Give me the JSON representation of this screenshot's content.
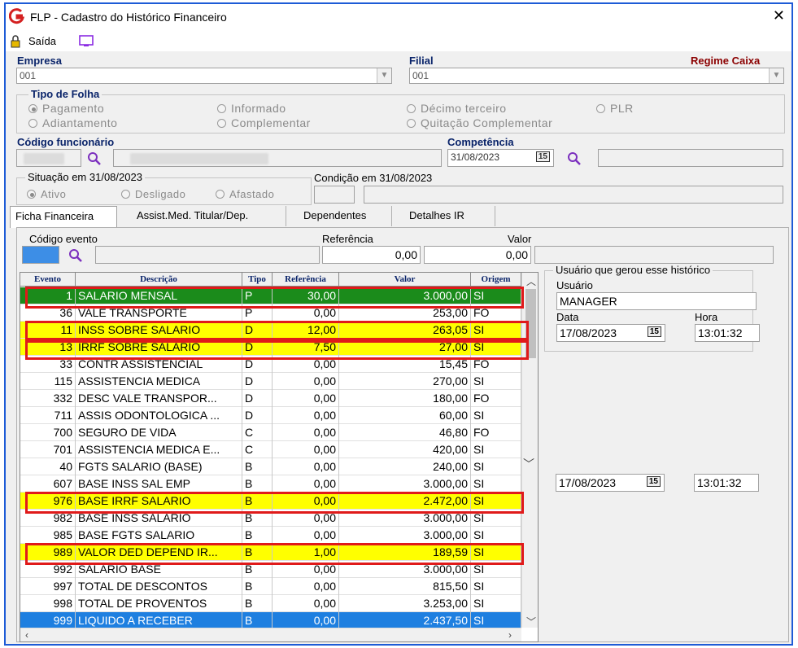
{
  "window": {
    "title": "FLP - Cadastro do Histórico Financeiro"
  },
  "menu": {
    "saida": "Saída"
  },
  "empresa": {
    "label": "Empresa",
    "value": "001"
  },
  "filial": {
    "label": "Filial",
    "value": "001",
    "regime": "Regime Caixa"
  },
  "tipo_folha": {
    "legend": "Tipo de Folha",
    "options": [
      "Pagamento",
      "Informado",
      "Décimo terceiro",
      "PLR",
      "Adiantamento",
      "Complementar",
      "Quitação Complementar"
    ],
    "selected": "Pagamento"
  },
  "funcionario": {
    "label": "Código funcionário"
  },
  "competencia": {
    "label": "Competência",
    "value": "31/08/2023",
    "cal": "15"
  },
  "situacao": {
    "legend": "Situação em  31/08/2023",
    "options": [
      "Ativo",
      "Desligado",
      "Afastado"
    ],
    "selected": "Ativo"
  },
  "condicao": {
    "label": "Condição em 31/08/2023"
  },
  "tabs": [
    "Ficha Financeira",
    "Assist.Med. Titular/Dep.",
    "Dependentes",
    "Detalhes IR"
  ],
  "evento_filter": {
    "codigo_label": "Código evento",
    "ref_label": "Referência",
    "valor_label": "Valor",
    "ref_value": "0,00",
    "valor_value": "0,00"
  },
  "grid": {
    "headers": [
      "Evento",
      "Descrição",
      "Tipo",
      "Referência",
      "Valor",
      "Origem"
    ],
    "rows": [
      [
        "1",
        "SALARIO MENSAL",
        "P",
        "30,00",
        "3.000,00",
        "SI"
      ],
      [
        "36",
        "VALE TRANSPORTE",
        "P",
        "0,00",
        "253,00",
        "FO"
      ],
      [
        "11",
        "INSS SOBRE SALARIO",
        "D",
        "12,00",
        "263,05",
        "SI"
      ],
      [
        "13",
        "IRRF SOBRE SALARIO",
        "D",
        "7,50",
        "27,00",
        "SI"
      ],
      [
        "33",
        "CONTR ASSISTENCIAL",
        "D",
        "0,00",
        "15,45",
        "FO"
      ],
      [
        "115",
        "ASSISTENCIA MEDICA",
        "D",
        "0,00",
        "270,00",
        "SI"
      ],
      [
        "332",
        "DESC VALE TRANSPOR...",
        "D",
        "0,00",
        "180,00",
        "FO"
      ],
      [
        "711",
        "ASSIS ODONTOLOGICA ...",
        "D",
        "0,00",
        "60,00",
        "SI"
      ],
      [
        "700",
        "SEGURO DE VIDA",
        "C",
        "0,00",
        "46,80",
        "FO"
      ],
      [
        "701",
        "ASSISTENCIA MEDICA E...",
        "C",
        "0,00",
        "420,00",
        "SI"
      ],
      [
        "40",
        "FGTS SALARIO (BASE)",
        "B",
        "0,00",
        "240,00",
        "SI"
      ],
      [
        "607",
        "BASE INSS SAL EMP",
        "B",
        "0,00",
        "3.000,00",
        "SI"
      ],
      [
        "976",
        "BASE IRRF SALARIO",
        "B",
        "0,00",
        "2.472,00",
        "SI"
      ],
      [
        "982",
        "BASE INSS SALARIO",
        "B",
        "0,00",
        "3.000,00",
        "SI"
      ],
      [
        "985",
        "BASE FGTS SALARIO",
        "B",
        "0,00",
        "3.000,00",
        "SI"
      ],
      [
        "989",
        "VALOR DED DEPEND IR...",
        "B",
        "1,00",
        "189,59",
        "SI"
      ],
      [
        "992",
        "SALARIO BASE",
        "B",
        "0,00",
        "3.000,00",
        "SI"
      ],
      [
        "997",
        "TOTAL DE DESCONTOS",
        "B",
        "0,00",
        "815,50",
        "SI"
      ],
      [
        "998",
        "TOTAL DE PROVENTOS",
        "B",
        "0,00",
        "3.253,00",
        "SI"
      ],
      [
        "999",
        "LIQUIDO A RECEBER",
        "B",
        "0,00",
        "2.437,50",
        "SI"
      ]
    ],
    "row_styles": [
      "green",
      "",
      "yellow",
      "yellow",
      "",
      "",
      "",
      "",
      "",
      "",
      "",
      "",
      "yellow",
      "",
      "",
      "yellow",
      "",
      "",
      "",
      "blue"
    ]
  },
  "usuario_box": {
    "legend": "Usuário que gerou esse histórico",
    "usuario_label": "Usuário",
    "usuario": "MANAGER",
    "data_label": "Data",
    "data": "17/08/2023",
    "hora_label": "Hora",
    "hora": "13:01:32",
    "cal": "15"
  },
  "second": {
    "data": "17/08/2023",
    "hora": "13:01:32",
    "cal": "15"
  },
  "colors": {
    "highlight_green": "#1b8b1b",
    "highlight_yellow": "#ffff00",
    "selected_blue": "#1e7fe0",
    "annotation_red": "#e01a1a"
  }
}
